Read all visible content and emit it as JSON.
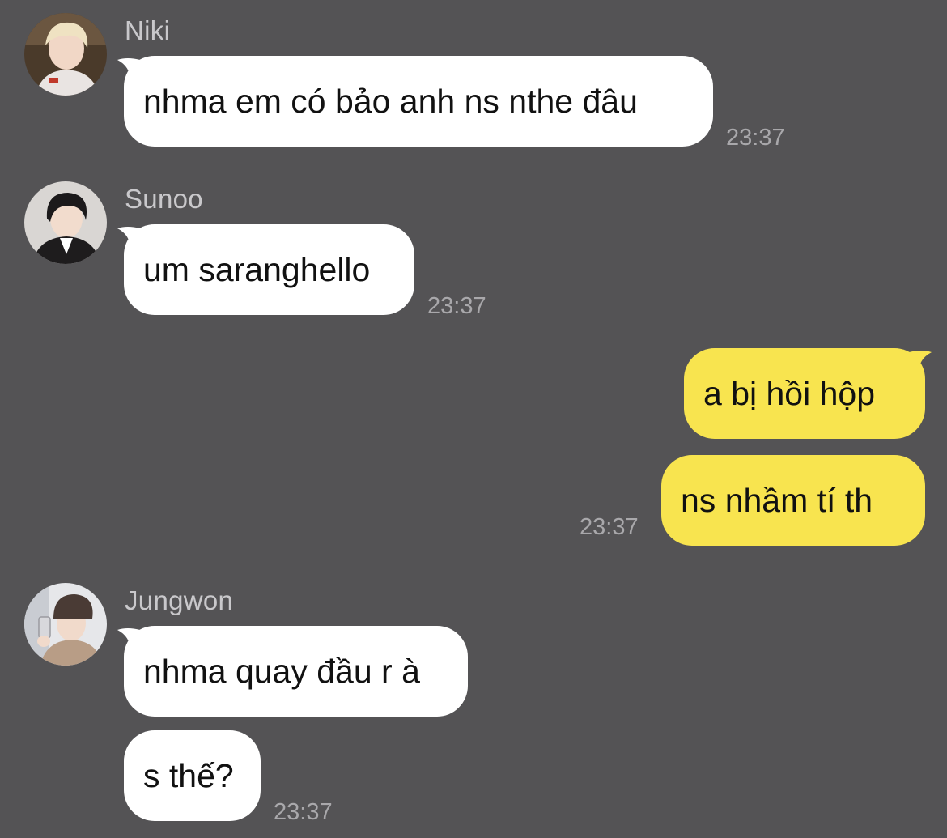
{
  "colors": {
    "background": "#545355",
    "incoming_bubble": "#ffffff",
    "outgoing_bubble": "#f8e44f",
    "sender_name": "#c9c8cb",
    "timestamp": "#a9a8ab"
  },
  "messages": [
    {
      "sender": "Niki",
      "avatar_icon": "user-avatar-niki",
      "bubbles": [
        "nhma em có bảo anh ns nthe đâu"
      ],
      "time": "23:37"
    },
    {
      "sender": "Sunoo",
      "avatar_icon": "user-avatar-sunoo",
      "bubbles": [
        "um saranghello"
      ],
      "time": "23:37"
    },
    {
      "sender": "me",
      "bubbles": [
        "a bị hồi hộp",
        "ns nhầm tí th"
      ],
      "time": "23:37"
    },
    {
      "sender": "Jungwon",
      "avatar_icon": "user-avatar-jungwon",
      "bubbles": [
        "nhma quay đầu r à",
        "s thế?"
      ],
      "time": "23:37"
    }
  ]
}
